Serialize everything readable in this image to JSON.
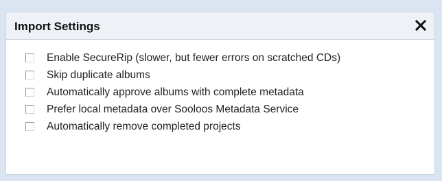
{
  "dialog": {
    "title": "Import Settings",
    "close_icon": "close-icon"
  },
  "options": [
    {
      "label": "Enable SecureRip (slower, but fewer errors on scratched CDs)",
      "checked": false
    },
    {
      "label": "Skip duplicate albums",
      "checked": false
    },
    {
      "label": "Automatically approve albums with complete metadata",
      "checked": false
    },
    {
      "label": "Prefer local metadata over Sooloos Metadata Service",
      "checked": false
    },
    {
      "label": "Automatically remove completed projects",
      "checked": false
    }
  ],
  "colors": {
    "frame_background": "#dbe4f1",
    "title_bar_background": "#eef1f6",
    "border": "#c9d3e2"
  }
}
